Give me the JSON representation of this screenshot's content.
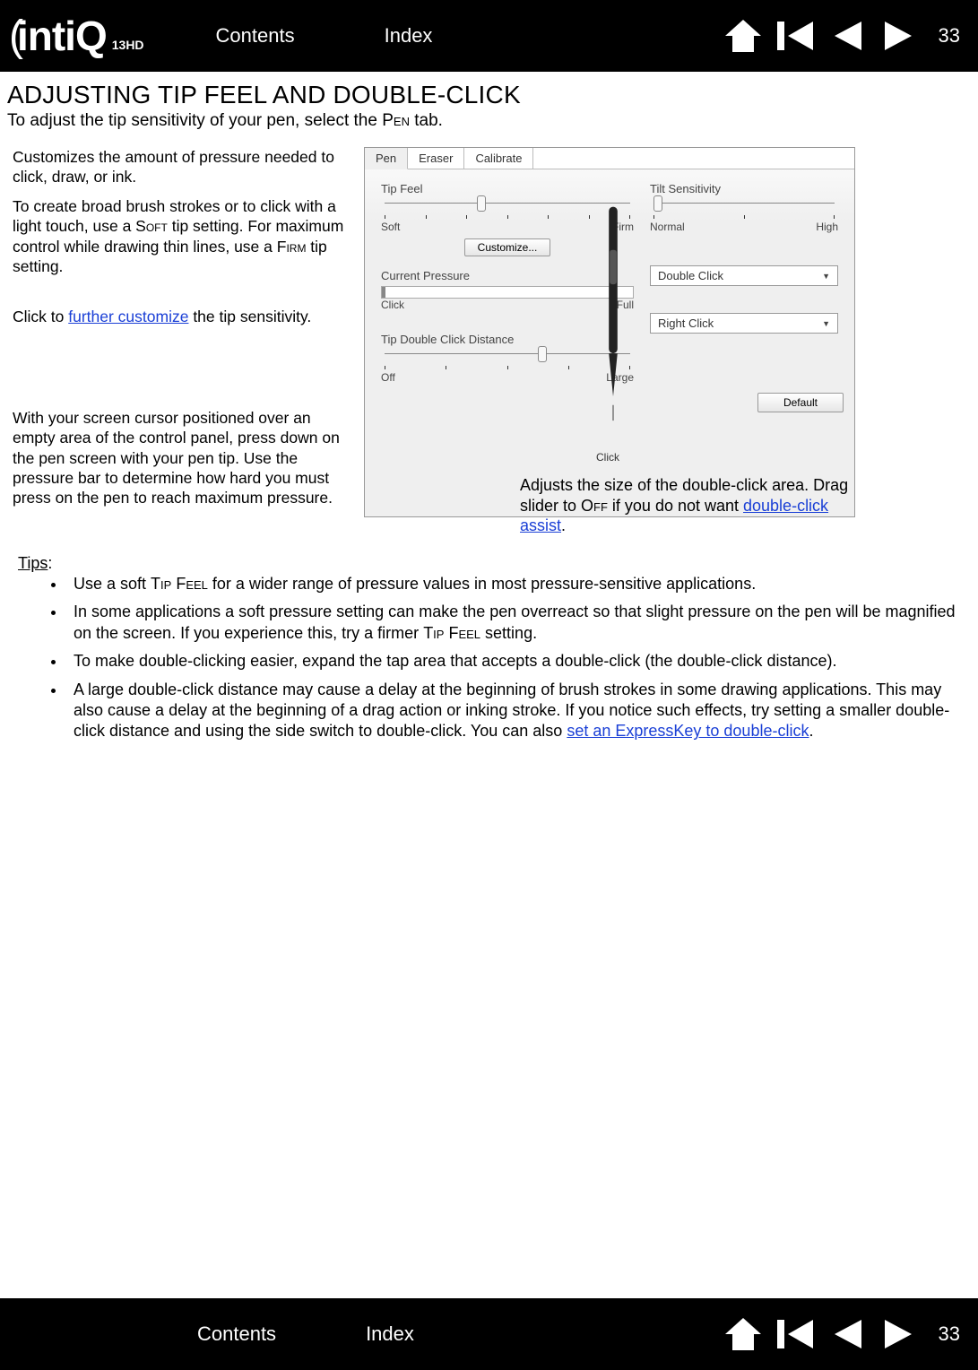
{
  "header": {
    "logo_main": "intiQ",
    "logo_sub": "13HD",
    "contents": "Contents",
    "index": "Index",
    "page_number": "33"
  },
  "heading": "ADJUSTING TIP FEEL AND DOUBLE-CLICK",
  "sub_prefix": "To adjust the tip sensitivity of your pen, select the ",
  "sub_pen": "Pen",
  "sub_suffix": " tab.",
  "left": {
    "p1": "Customizes the amount of pressure needed to click, draw, or ink.",
    "p2_a": "To create broad brush strokes or to click with a light touch, use a ",
    "p2_soft": "Soft",
    "p2_mid": " tip setting. For maximum control while drawing thin lines, use a ",
    "p2_firm": "Firm",
    "p2_end": " tip setting.",
    "p3_a": "Click to ",
    "p3_link": "further customize",
    "p3_b": " the tip sensitivity.",
    "p4": "With your screen cursor positioned over an empty area of the control panel, press down on the pen screen with your pen tip. Use the pressure bar to determine how hard you must press on the pen to reach maximum pressure."
  },
  "panel": {
    "tabs": [
      "Pen",
      "Eraser",
      "Calibrate"
    ],
    "tip_feel": {
      "label": "Tip Feel",
      "left": "Soft",
      "right": "Firm"
    },
    "customize_btn": "Customize...",
    "current_pressure": {
      "label": "Current Pressure",
      "left": "Click",
      "right": "Full"
    },
    "double_click_dist": {
      "label": "Tip Double Click Distance",
      "left": "Off",
      "right": "Large"
    },
    "tilt": {
      "label": "Tilt Sensitivity",
      "left": "Normal",
      "right": "High"
    },
    "dropdown1": "Double Click",
    "dropdown2": "Right Click",
    "click_label": "Click",
    "default_btn": "Default"
  },
  "callout_dbl_a": "Adjusts the size of the double-click area. Drag slider to ",
  "callout_dbl_off": "Off",
  "callout_dbl_b": " if you do not want ",
  "callout_dbl_link": "double-click assist",
  "callout_dbl_c": ".",
  "tips_heading": "Tips",
  "tips_colon": ":",
  "tips": {
    "t1_a": "Use a soft ",
    "t1_sc": "Tip Feel",
    "t1_b": " for a wider range of pressure values in most pressure-sensitive applications.",
    "t2_a": "In some applications a soft pressure setting can make the pen overreact so that slight pressure on the pen will be magnified on the screen. If you experience this, try a firmer ",
    "t2_sc": "Tip Feel",
    "t2_b": " setting.",
    "t3": "To make double-clicking easier, expand the tap area that accepts a double-click (the double-click distance).",
    "t4_a": "A large double-click distance may cause a delay at the beginning of brush strokes in some drawing applications. This may also cause a delay at the beginning of a drag action or inking stroke. If you notice such effects, try setting a smaller double-click distance and using the side switch to double-click. You can also ",
    "t4_link": "set an ExpressKey to double-click",
    "t4_b": "."
  },
  "footer": {
    "contents": "Contents",
    "index": "Index",
    "page_number": "33"
  }
}
